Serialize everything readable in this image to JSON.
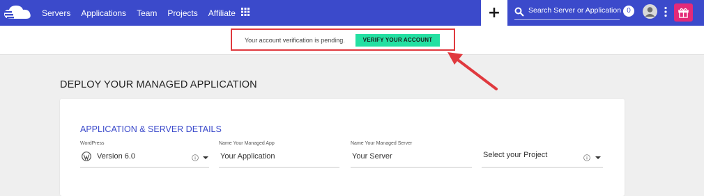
{
  "nav": {
    "items": [
      "Servers",
      "Applications",
      "Team",
      "Projects",
      "Affiliate"
    ],
    "add_symbol": "+",
    "search_placeholder": "Search Server or Application",
    "notification_count": "0"
  },
  "banner": {
    "text": "Your account verification is pending.",
    "verify_label": "VERIFY YOUR ACCOUNT"
  },
  "page": {
    "title": "DEPLOY YOUR MANAGED APPLICATION"
  },
  "details": {
    "section_title": "APPLICATION & SERVER DETAILS",
    "app_type_label": "WordPress",
    "app_version": "Version 6.0",
    "app_name_label": "Name Your Managed App",
    "app_name_value": "Your Application",
    "server_name_label": "Name Your Managed Server",
    "server_name_value": "Your Server",
    "project_value": "Select your Project"
  },
  "colors": {
    "nav_bg": "#3b4acb",
    "verify_btn": "#24e0a2",
    "highlight": "#e0393e",
    "gift_bg": "#e32a78"
  }
}
